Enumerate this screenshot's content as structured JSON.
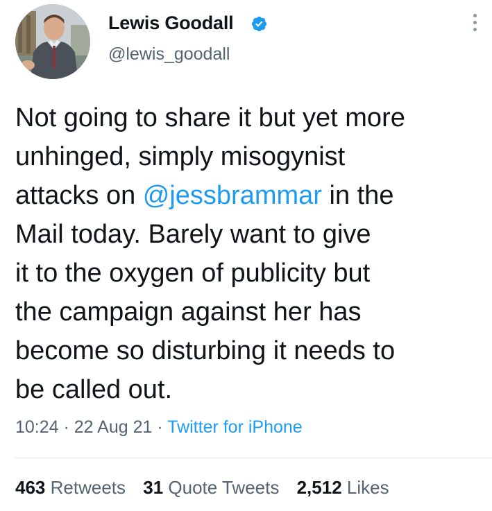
{
  "author": {
    "name": "Lewis Goodall",
    "handle": "@lewis_goodall",
    "verified": true
  },
  "tweet": {
    "lines": [
      [
        "Not going to share it but yet more"
      ],
      [
        "unhinged, simply misogynist"
      ],
      [
        "attacks on ",
        "@jessbrammar",
        " in the"
      ],
      [
        "Mail today. Barely want to give"
      ],
      [
        "it to the oxygen of publicity but"
      ],
      [
        "the campaign against her has"
      ],
      [
        "become so disturbing it needs to"
      ],
      [
        "be called out."
      ]
    ],
    "time": "10:24",
    "separator1": " · ",
    "date": "22 Aug 21",
    "separator2": " · ",
    "source": "Twitter for iPhone"
  },
  "stats": {
    "retweets_count": "463",
    "retweets_label": "Retweets",
    "quotes_count": "31",
    "quotes_label": "Quote Tweets",
    "likes_count": "2,512",
    "likes_label": "Likes"
  },
  "colors": {
    "link": "#1d9bf0",
    "secondary_text": "#536471",
    "primary_text": "#0f1419",
    "verified_badge": "#1d9bf0"
  },
  "icons": {
    "verified": "verified-badge-icon",
    "more": "more-options-icon"
  }
}
